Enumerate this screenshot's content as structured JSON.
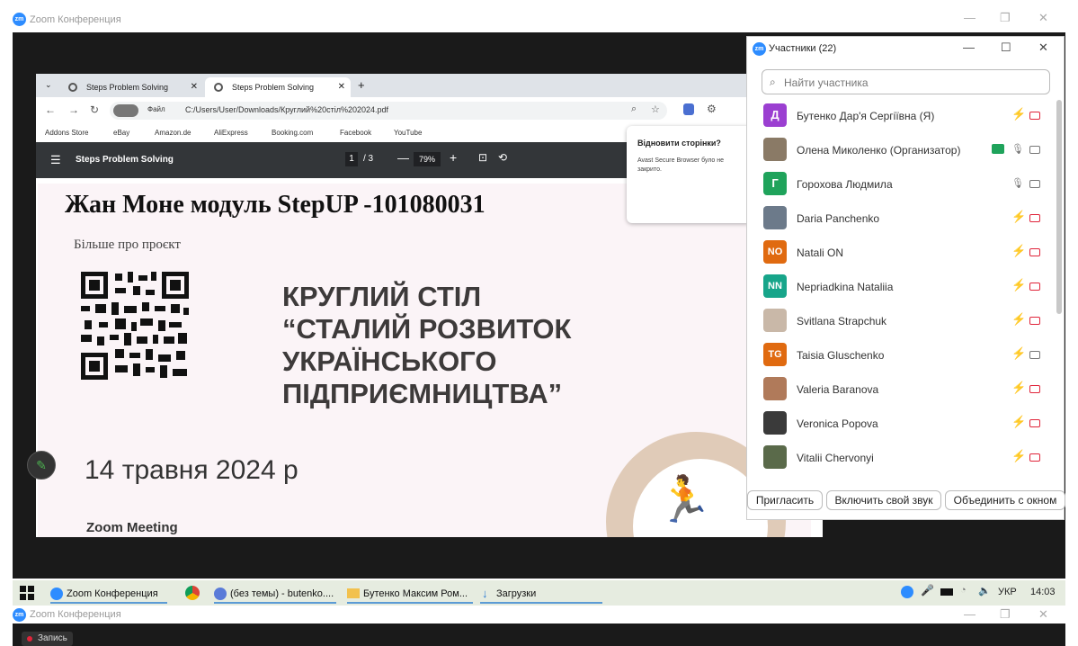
{
  "zoom_window": {
    "title": "Zoom Конференция",
    "logo": "zm"
  },
  "browser": {
    "tabs": [
      {
        "label": "Steps Problem Solving"
      },
      {
        "label": "Steps Problem Solving"
      }
    ],
    "new_tab": "+",
    "address": {
      "badge": "Файл",
      "url": "C:/Users/User/Downloads/Круглий%20стіл%202024.pdf"
    },
    "bookmarks": [
      "Addons Store",
      "eBay",
      "Amazon.de",
      "AliExpress",
      "Booking.com",
      "Facebook",
      "YouTube"
    ],
    "pdf": {
      "title": "Steps Problem Solving",
      "page_current": "1",
      "page_total": "/ 3",
      "zoom": "79%"
    },
    "popup": {
      "title": "Відновити сторінки?",
      "body": "Avast Secure Browser було не закрито."
    }
  },
  "slide": {
    "heading": "Жан Моне модуль StepUP -101080031",
    "more": "Більше про проєкт",
    "title_lines": [
      "КРУГЛИЙ СТІЛ",
      "“СТАЛИЙ РОЗВИТОК",
      "УКРАЇНСЬКОГО",
      "ПІДПРИЄМНИЦТВА”"
    ],
    "date_day": "14",
    "date_month": "травня",
    "date_year": "2024",
    "date_suffix": "р",
    "zoom_meeting": "Zoom Meeting"
  },
  "participants": {
    "title": "Участники (22)",
    "search_placeholder": "Найти участника",
    "list": [
      {
        "initials": "Д",
        "name": "Бутенко Дар'я Сергіївна (Я)",
        "color": "#9b3fd1",
        "mic": "muted",
        "video": "off"
      },
      {
        "initials": "",
        "name": "Олена Миколенко (Организатор)",
        "color": "#8a7a66",
        "mic": "on",
        "video": "on",
        "share": true
      },
      {
        "initials": "Г",
        "name": "Горохова Людмила",
        "color": "#1fa35b",
        "mic": "on",
        "video": "on"
      },
      {
        "initials": "",
        "name": "Daria Panchenko",
        "color": "#6c7a8a",
        "mic": "muted",
        "video": "off"
      },
      {
        "initials": "NO",
        "name": "Natali ON",
        "color": "#e06a10",
        "mic": "muted",
        "video": "off"
      },
      {
        "initials": "NN",
        "name": "Nepriadkina Nataliia",
        "color": "#17a58a",
        "mic": "muted",
        "video": "off"
      },
      {
        "initials": "",
        "name": "Svitlana Strapchuk",
        "color": "#c9b8a8",
        "mic": "muted",
        "video": "off"
      },
      {
        "initials": "TG",
        "name": "Taisia Gluschenko",
        "color": "#e06a10",
        "mic": "muted",
        "video": "on"
      },
      {
        "initials": "",
        "name": "Valeria Baranova",
        "color": "#b07a5a",
        "mic": "muted",
        "video": "off"
      },
      {
        "initials": "",
        "name": "Veronica Popova",
        "color": "#3a3a3a",
        "mic": "muted",
        "video": "off"
      },
      {
        "initials": "",
        "name": "Vitalii Chervonyi",
        "color": "#5a6a4a",
        "mic": "muted",
        "video": "off"
      }
    ],
    "buttons": {
      "invite": "Пригласить",
      "unmute": "Включить свой звук",
      "merge": "Объединить с окном"
    }
  },
  "taskbar": {
    "items": [
      "Zoom Конференция",
      "(без темы) - butenko....",
      "Бутенко Максим Ром...",
      "Загрузки"
    ],
    "lang": "УКР",
    "time": "14:03"
  },
  "recording": {
    "label": "Запись"
  }
}
